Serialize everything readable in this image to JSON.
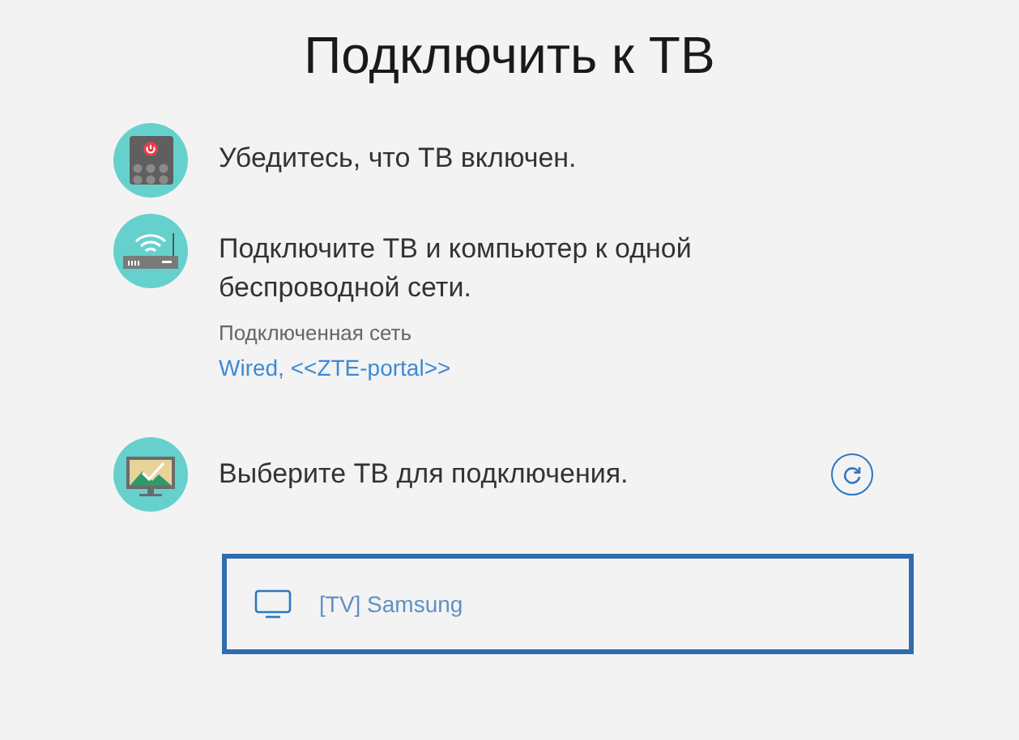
{
  "title": "Подключить к ТВ",
  "steps": [
    {
      "kind": "power",
      "text": "Убедитесь, что ТВ включен."
    },
    {
      "kind": "network",
      "text": "Подключите ТВ и компьютер к одной беспроводной сети.",
      "network_label": "Подключенная сеть",
      "network_link": "Wired, <<ZTE-portal>>"
    },
    {
      "kind": "select",
      "text": "Выберите ТВ для подключения."
    }
  ],
  "devices": [
    {
      "name": "[TV] Samsung",
      "selected": true
    }
  ]
}
